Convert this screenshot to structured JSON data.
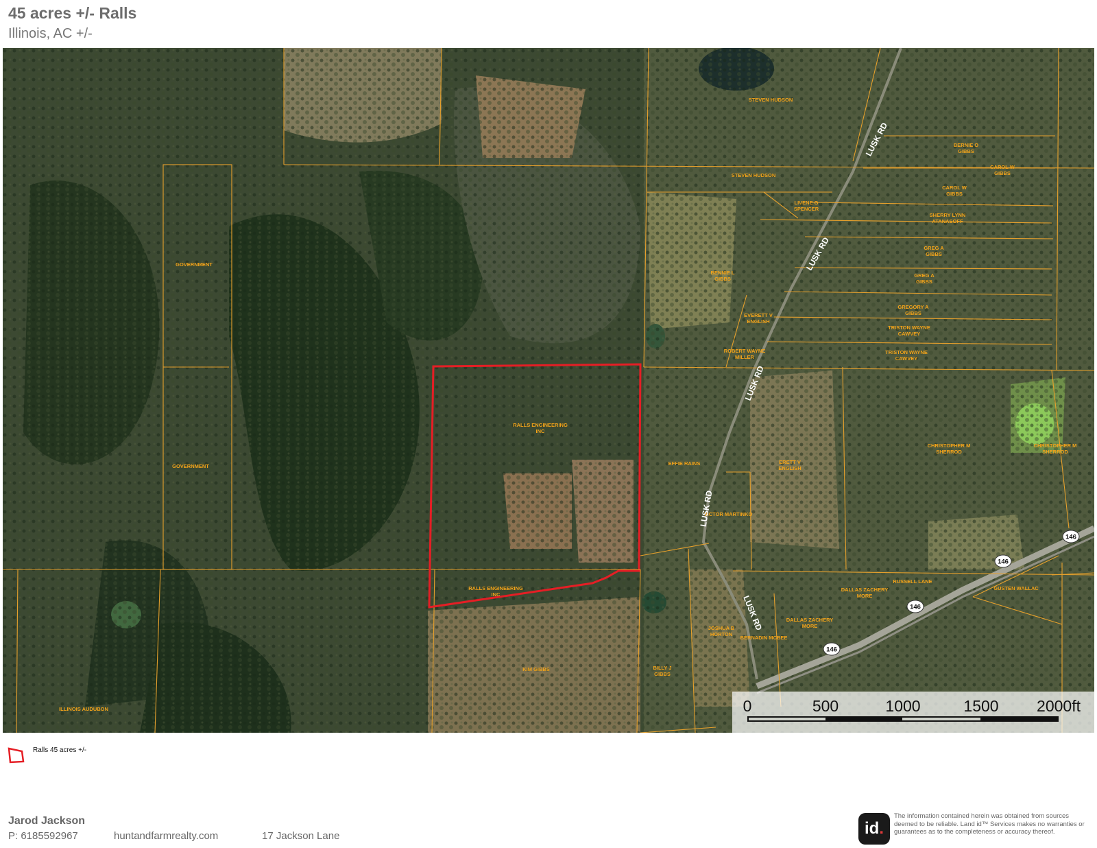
{
  "header": {
    "title": "45 acres +/- Ralls",
    "subtitle": "Illinois,  AC +/-"
  },
  "map": {
    "parcels": [
      "STEVEN HUDSON",
      "STEVEN HUDSON",
      "BERNIE O GIBBS",
      "CAROL W GIBBS",
      "CAROL W GIBBS",
      "LIVENE G SPENCER",
      "SHERRY LYNN ATANASOFF",
      "GREG A GIBBS",
      "GREG A GIBBS",
      "BENNIE L GIBBS",
      "EVERETT V ENGLISH",
      "GREGORY A GIBBS",
      "TRISTON WAYNE CAWVEY",
      "TRISTON WAYNE CAWVEY",
      "ROBERT WAYNE MILLER",
      "GOVERNMENT",
      "GOVERNMENT",
      "RALLS ENGINEERING INC",
      "RALLS ENGINEERING INC",
      "EFFIE RAINS",
      "ERETT V ENGLISH",
      "CHRISTOPHER M SHERROD",
      "CHRISTOPHER M SHERROD",
      "VICTOR MARTINKO",
      "RUSSELL LANE",
      "DALLAS ZACHERY MORE",
      "DALLAS ZACHERY MORE",
      "GUSTEN WALLAC",
      "JOSHUA B HORTON",
      "BERNADIN MCBEE",
      "KIM GIBBS",
      "BILLY J GIBBS",
      "ILLINOIS AUDUBON"
    ],
    "roads": [
      "LUSK RD",
      "LUSK RD",
      "LUSK RD",
      "LUSK RD",
      "LUSK RD"
    ],
    "highway": "146",
    "scale_labels": [
      "0",
      "500",
      "1000",
      "1500",
      "2000ft"
    ]
  },
  "legend": {
    "label": "Ralls 45 acres +/-",
    "color": "#e51e25"
  },
  "footer": {
    "agent_name": "Jarod Jackson",
    "phone": "P: 6185592967",
    "website": "huntandfarmrealty.com",
    "address": "17 Jackson Lane",
    "logo_text": "id",
    "logo_dot": ".",
    "disclaimer": "The information contained herein was obtained from sources deemed to be reliable. Land id™ Services makes no warranties or guarantees as to the completeness or accuracy thereof."
  }
}
